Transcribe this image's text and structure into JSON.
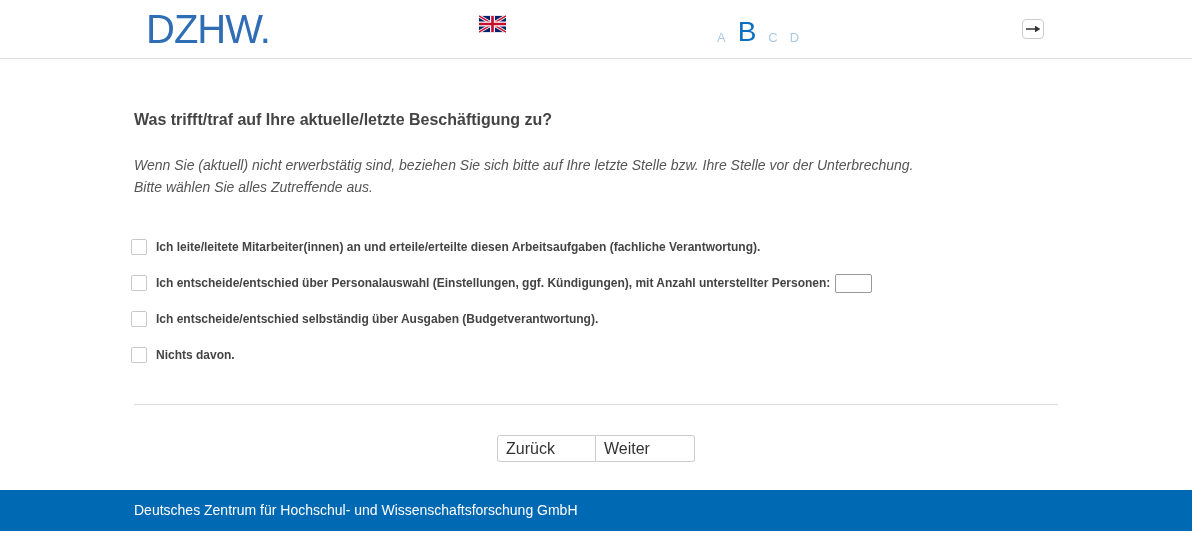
{
  "header": {
    "logo": "DZHW.",
    "font_sizes": [
      {
        "label": "A",
        "selected": false
      },
      {
        "label": "B",
        "selected": true
      },
      {
        "label": "C",
        "selected": false
      },
      {
        "label": "D",
        "selected": false
      }
    ]
  },
  "question": {
    "title": "Was trifft/traf auf Ihre aktuelle/letzte Beschäftigung zu?",
    "hint_lines": [
      "Wenn Sie (aktuell) nicht erwerbstätig sind, beziehen Sie sich bitte auf Ihre letzte Stelle bzw. Ihre Stelle vor der Unterbrechung.",
      "Bitte wählen Sie alles Zutreffende aus."
    ],
    "options": [
      {
        "kind": "plain",
        "label": "Ich leite/leitete Mitarbeiter(innen) an und erteile/erteilte diesen Arbeitsaufgaben (fachliche Verantwortung).",
        "checked": false
      },
      {
        "kind": "number",
        "label": "Ich entscheide/entschied über Personalauswahl (Einstellungen, ggf. Kündigungen), mit Anzahl unterstellter Personen:",
        "checked": false
      },
      {
        "kind": "plain",
        "label": "Ich entscheide/entschied selbständig über Ausgaben (Budgetverantwortung).",
        "checked": false
      },
      {
        "kind": "plain",
        "label": "Nichts davon.",
        "checked": false
      }
    ]
  },
  "buttons": [
    "Zurück",
    "Weiter"
  ],
  "footer": "Deutsches Zentrum für Hochschul- und Wissenschaftsforschung GmbH"
}
